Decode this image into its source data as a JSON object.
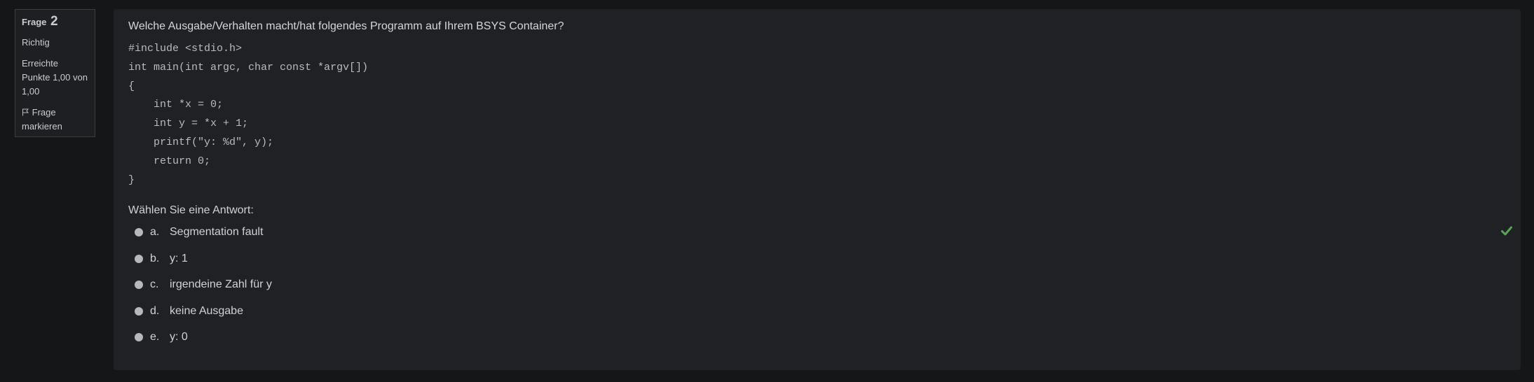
{
  "info": {
    "question_label": "Frage",
    "question_number": "2",
    "state": "Richtig",
    "grade": "Erreichte Punkte 1,00 von 1,00",
    "flag_label": "Frage markieren"
  },
  "question": {
    "text": "Welche Ausgabe/Verhalten macht/hat folgendes Programm auf Ihrem BSYS Container?",
    "code": "#include <stdio.h>\nint main(int argc, char const *argv[])\n{\n    int *x = 0;\n    int y = *x + 1;\n    printf(\"y: %d\", y);\n    return 0;\n}",
    "prompt": "Wählen Sie eine Antwort:"
  },
  "answers": [
    {
      "letter": "a.",
      "text": "Segmentation fault"
    },
    {
      "letter": "b.",
      "text": "y: 1"
    },
    {
      "letter": "c.",
      "text": "irgendeine Zahl für y"
    },
    {
      "letter": "d.",
      "text": "keine Ausgabe"
    },
    {
      "letter": "e.",
      "text": "y: 0"
    }
  ],
  "colors": {
    "page_bg": "#151618",
    "panel_bg": "#202124",
    "correct": "#5aa35a"
  },
  "icons": {
    "flag": "flag-icon",
    "correct": "check-icon"
  }
}
